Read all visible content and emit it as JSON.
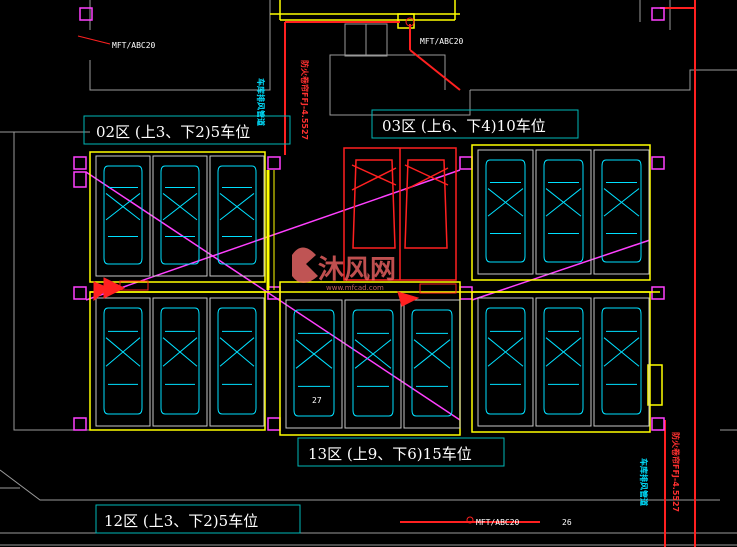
{
  "zones": {
    "z02": "02区 (上3、下2)5车位",
    "z03": "03区 (上6、下4)10车位",
    "z13": "13区 (上9、下6)15车位",
    "z12": "12区 (上3、下2)5车位"
  },
  "tags": {
    "mft1": "MFT/ABC20",
    "mft2": "MFT/ABC20",
    "mft3": "MFT/ABC20",
    "num26": "26",
    "num27": "27"
  },
  "vertical": {
    "fireshutter1": "防火卷帘FFJ-4.5527",
    "fireshutter2": "防火卷帘FFJ-4.5527",
    "pipe1": "车库排风管道",
    "pipe2": "车库排风管道"
  },
  "watermark": "沐风网",
  "watermark_url": "www.mfcad.com",
  "colors": {
    "wall": "#9a9a9a",
    "car": "#00e0ff",
    "red": "#ff2020",
    "yellow": "#ffff00",
    "magenta": "#ff40ff",
    "label_border": "#00b8b8"
  }
}
